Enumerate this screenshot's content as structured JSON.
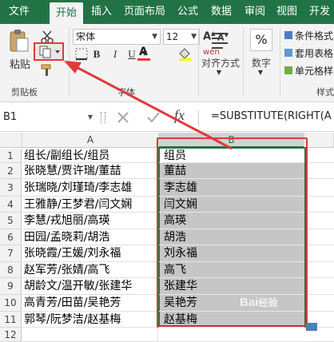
{
  "tabs": [
    "文件",
    "开始",
    "插入",
    "页面布局",
    "公式",
    "数据",
    "审阅",
    "视图",
    "开发"
  ],
  "active_tab_index": 1,
  "clipboard": {
    "paste_label": "粘贴",
    "group_label": "剪贴板"
  },
  "font": {
    "name": "宋体",
    "size": "12",
    "group_label": "字体",
    "bold": "B",
    "italic": "I",
    "underline": "U",
    "grow": "A",
    "shrink": "A",
    "wen": "wén",
    "font_color": "A"
  },
  "alignment": {
    "label": "对齐方式"
  },
  "number": {
    "percent": "%",
    "label": "数字"
  },
  "styles": {
    "items": [
      "条件格式",
      "套用表格",
      "单元格样"
    ],
    "group_label": "样式"
  },
  "formula_bar": {
    "name_box": "B1",
    "fx": "fx",
    "formula": "=SUBSTITUTE(RIGHT(A"
  },
  "columns": [
    "A",
    "B"
  ],
  "rows": [
    {
      "n": "1",
      "a": "组长/副组长/组员",
      "b": "组员"
    },
    {
      "n": "2",
      "a": "张晓慧/贾许瑞/董喆",
      "b": "董喆"
    },
    {
      "n": "3",
      "a": "张瑞晓/刘瑾琦/李志雄",
      "b": "李志雄"
    },
    {
      "n": "4",
      "a": "王雅静/王梦君/闫文娴",
      "b": "闫文娴"
    },
    {
      "n": "5",
      "a": "李慧/戎旭丽/高瑛",
      "b": "高瑛"
    },
    {
      "n": "6",
      "a": "田园/孟晓莉/胡浩",
      "b": "胡浩"
    },
    {
      "n": "7",
      "a": "张晓霞/王媛/刘永福",
      "b": "刘永福"
    },
    {
      "n": "8",
      "a": "赵军芳/张婧/高飞",
      "b": "高飞"
    },
    {
      "n": "9",
      "a": "胡龄文/温开敏/张建华",
      "b": "张建华"
    },
    {
      "n": "10",
      "a": "高青芳/田苗/吴艳芳",
      "b": "吴艳芳"
    },
    {
      "n": "11",
      "a": "郭琴/阮梦洁/赵基梅",
      "b": "赵基梅"
    },
    {
      "n": "12",
      "a": "",
      "b": ""
    }
  ],
  "colors": {
    "excel_green": "#217346",
    "highlight_red": "#e03a3a",
    "selection_gray": "#c6c6c6",
    "selection_border": "#217346"
  }
}
